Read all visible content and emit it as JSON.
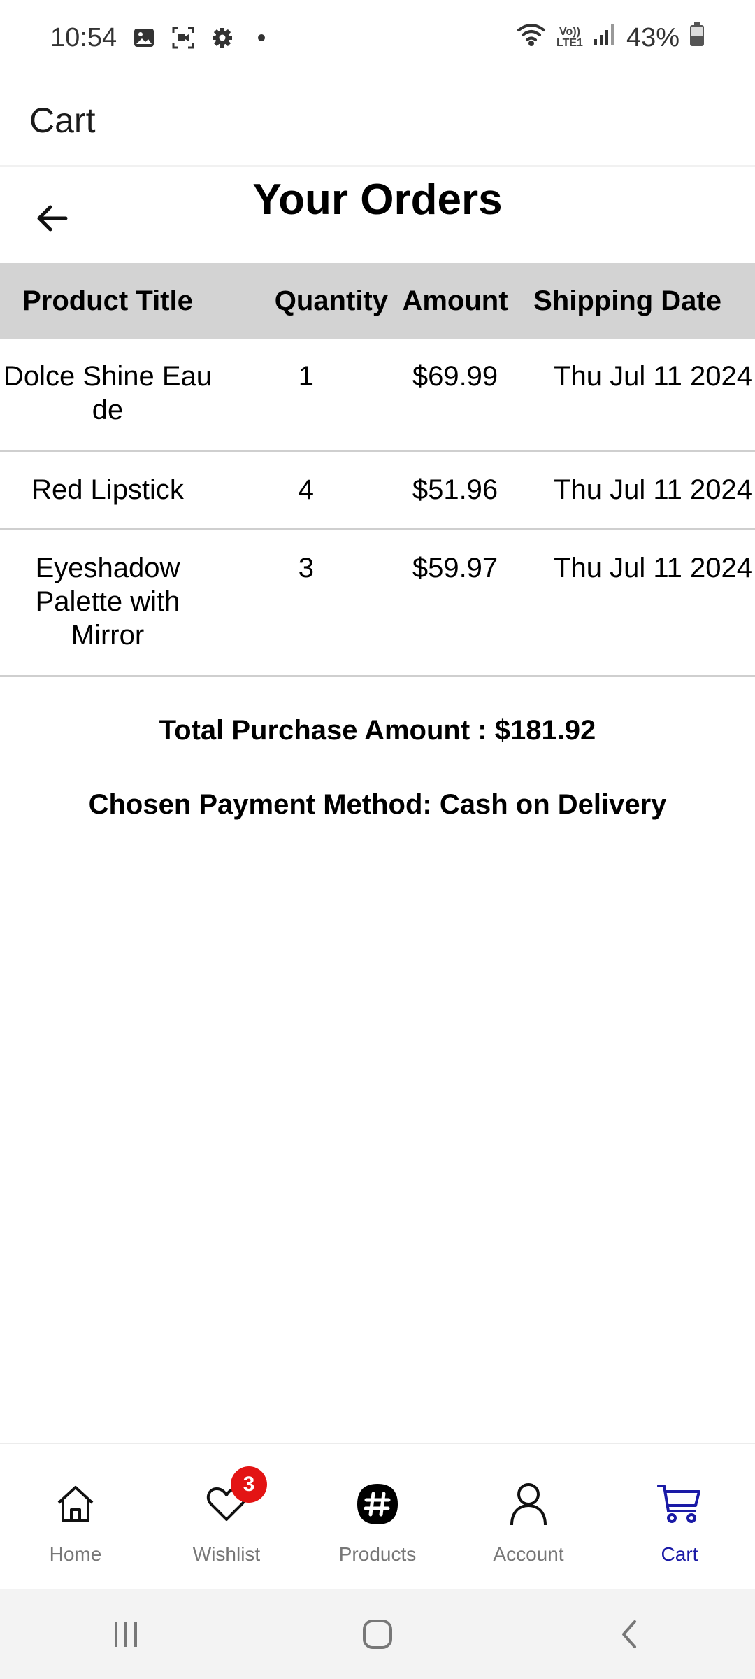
{
  "status_bar": {
    "time": "10:54",
    "battery": "43%",
    "lte_top": "Vo))",
    "lte_bottom": "LTE1"
  },
  "header": {
    "title": "Cart"
  },
  "page": {
    "title": "Your Orders"
  },
  "table": {
    "headers": [
      "Product Title",
      "Quantity",
      "Amount",
      "Shipping Date"
    ],
    "rows": [
      {
        "title": "Dolce Shine Eau de",
        "quantity": "1",
        "amount": "$69.99",
        "date": "Thu Jul 11 2024"
      },
      {
        "title": "Red Lipstick",
        "quantity": "4",
        "amount": "$51.96",
        "date": "Thu Jul 11 2024"
      },
      {
        "title": "Eyeshadow Palette with Mirror",
        "quantity": "3",
        "amount": "$59.97",
        "date": "Thu Jul 11 2024"
      }
    ]
  },
  "summary": {
    "total": "Total Purchase Amount : $181.92",
    "payment": "Chosen Payment Method: Cash on Delivery"
  },
  "bottom_nav": {
    "items": [
      {
        "label": "Home",
        "icon": "home-icon"
      },
      {
        "label": "Wishlist",
        "icon": "heart-icon",
        "badge": "3"
      },
      {
        "label": "Products",
        "icon": "products-icon"
      },
      {
        "label": "Account",
        "icon": "person-icon"
      },
      {
        "label": "Cart",
        "icon": "cart-icon"
      }
    ],
    "active": "Cart",
    "active_color": "#1a1aa6",
    "badge_color": "#e31414"
  }
}
